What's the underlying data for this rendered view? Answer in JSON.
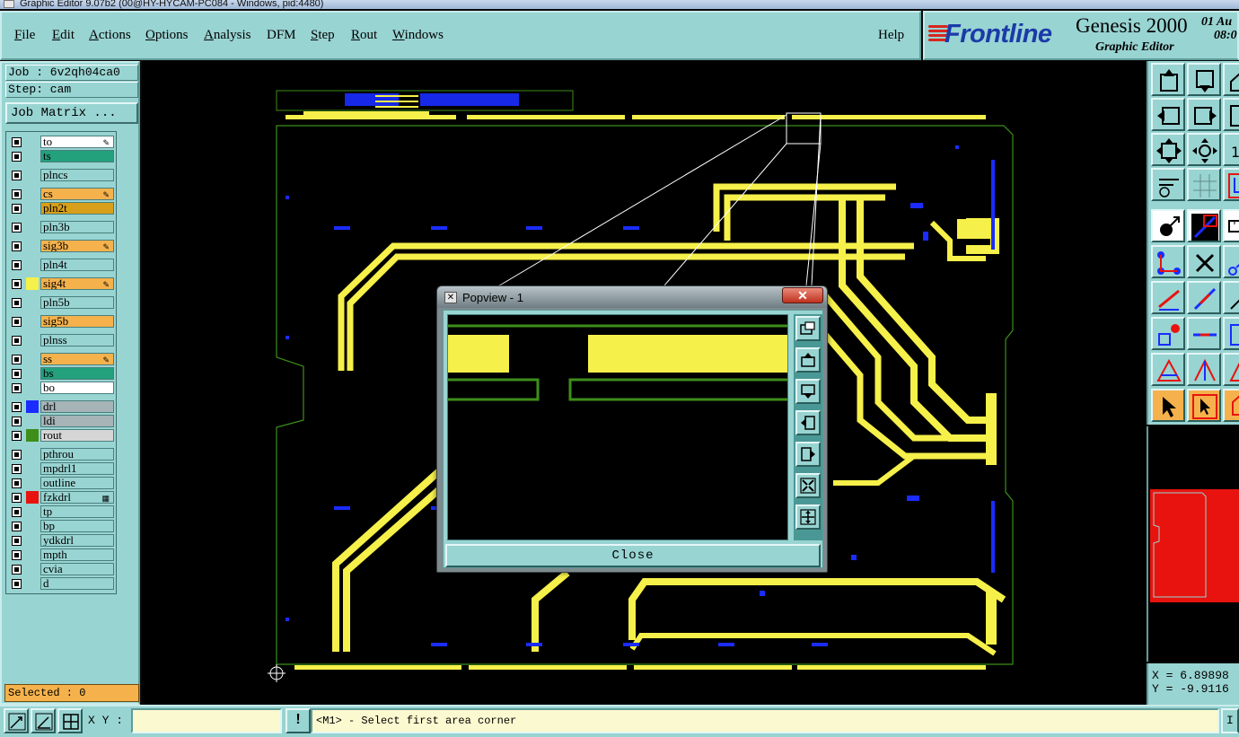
{
  "window": {
    "title": "Graphic Editor 9.07b2 (00@HY-HYCAM-PC084 - Windows, pid:4480)"
  },
  "menu": {
    "items": [
      {
        "label": "File",
        "u": "F",
        "rest": "ile"
      },
      {
        "label": "Edit",
        "u": "E",
        "rest": "dit"
      },
      {
        "label": "Actions",
        "u": "A",
        "rest": "ctions"
      },
      {
        "label": "Options",
        "u": "O",
        "rest": "ptions"
      },
      {
        "label": "Analysis",
        "u": "A",
        "rest": "nalysis"
      },
      {
        "label": "DFM",
        "u": "",
        "rest": "DFM"
      },
      {
        "label": "Step",
        "u": "S",
        "rest": "tep"
      },
      {
        "label": "Rout",
        "u": "R",
        "rest": "out"
      },
      {
        "label": "Windows",
        "u": "W",
        "rest": "indows"
      }
    ],
    "help": "Help"
  },
  "brand": {
    "logo": "Frontline",
    "product": "Genesis 2000",
    "subtitle": "Graphic Editor",
    "date": "01 Au",
    "time": "08:0"
  },
  "left": {
    "job": "Job : 6v2qh04ca0",
    "step": "Step: cam",
    "job_matrix": "Job Matrix ...",
    "layers": [
      {
        "name": "to",
        "bg": "#ffffff",
        "swatch": "",
        "mark": "✎"
      },
      {
        "name": "ts",
        "bg": "#23a07c",
        "swatch": "",
        "mark": ""
      },
      {
        "name": "plncs",
        "bg": "#98d4d2",
        "swatch": "",
        "mark": ""
      },
      {
        "name": "cs",
        "bg": "#f5b24c",
        "swatch": "",
        "mark": "✎"
      },
      {
        "name": "pln2t",
        "bg": "#d8a01a",
        "swatch": "",
        "mark": ""
      },
      {
        "name": "pln3b",
        "bg": "#98d4d2",
        "swatch": "",
        "mark": ""
      },
      {
        "name": "sig3b",
        "bg": "#f5b24c",
        "swatch": "",
        "mark": "✎"
      },
      {
        "name": "pln4t",
        "bg": "#98d4d2",
        "swatch": "",
        "mark": ""
      },
      {
        "name": "sig4t",
        "bg": "#f5b24c",
        "swatch": "#f6f04a",
        "mark": "✎"
      },
      {
        "name": "pln5b",
        "bg": "#98d4d2",
        "swatch": "",
        "mark": ""
      },
      {
        "name": "sig5b",
        "bg": "#f5b24c",
        "swatch": "",
        "mark": ""
      },
      {
        "name": "plnss",
        "bg": "#98d4d2",
        "swatch": "",
        "mark": ""
      },
      {
        "name": "ss",
        "bg": "#f5b24c",
        "swatch": "",
        "mark": "✎"
      },
      {
        "name": "bs",
        "bg": "#23a07c",
        "swatch": "",
        "mark": ""
      },
      {
        "name": "bo",
        "bg": "#ffffff",
        "swatch": "",
        "mark": ""
      },
      {
        "name": "drl",
        "bg": "#a6b4b8",
        "swatch": "#1a2cff",
        "mark": ""
      },
      {
        "name": "ldi",
        "bg": "#a6b4b8",
        "swatch": "",
        "mark": ""
      },
      {
        "name": "rout",
        "bg": "#d6d6d6",
        "swatch": "#3e8e1a",
        "mark": ""
      },
      {
        "name": "pthrou",
        "bg": "#98d4d2",
        "swatch": "",
        "mark": ""
      },
      {
        "name": "mpdrl1",
        "bg": "#98d4d2",
        "swatch": "",
        "mark": ""
      },
      {
        "name": "outline",
        "bg": "#98d4d2",
        "swatch": "",
        "mark": ""
      },
      {
        "name": "fzkdrl",
        "bg": "#98d4d2",
        "swatch": "#e8130f",
        "mark": "▦"
      },
      {
        "name": "tp",
        "bg": "#98d4d2",
        "swatch": "",
        "mark": ""
      },
      {
        "name": "bp",
        "bg": "#98d4d2",
        "swatch": "",
        "mark": ""
      },
      {
        "name": "ydkdrl",
        "bg": "#98d4d2",
        "swatch": "",
        "mark": ""
      },
      {
        "name": "mpth",
        "bg": "#98d4d2",
        "swatch": "",
        "mark": ""
      },
      {
        "name": "cvia",
        "bg": "#98d4d2",
        "swatch": "",
        "mark": ""
      },
      {
        "name": "d",
        "bg": "#98d4d2",
        "swatch": "",
        "mark": ""
      }
    ],
    "selected": "Selected : 0"
  },
  "popview": {
    "title": "Popview - 1",
    "close": "Close",
    "tools": [
      "zoom-fit-icon",
      "pan-up-icon",
      "pan-down-icon",
      "pan-left-icon",
      "pan-right-icon",
      "zoom-out-icon",
      "zoom-in-icon"
    ]
  },
  "right": {
    "coord_x": "X = 6.89898",
    "coord_y": "Y = -9.9116"
  },
  "bottom": {
    "xy_label": "X Y :",
    "xy_value": "",
    "warn": "!",
    "status": "<M1> - Select first area corner",
    "right_btn": "I"
  },
  "colors": {
    "panel": "#98d4d2",
    "trace": "#f6f04a",
    "outline": "#3e8e1a",
    "drill": "#1a2cff",
    "highlight": "#f5b24c",
    "overview_fill": "#e8130f"
  }
}
